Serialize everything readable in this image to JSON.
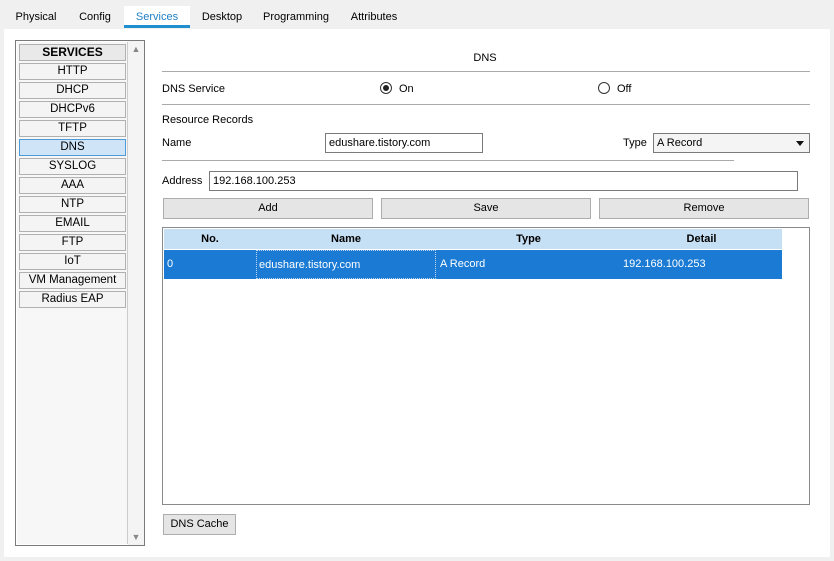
{
  "tabs": [
    {
      "label": "Physical"
    },
    {
      "label": "Config"
    },
    {
      "label": "Services"
    },
    {
      "label": "Desktop"
    },
    {
      "label": "Programming"
    },
    {
      "label": "Attributes"
    }
  ],
  "sidebar": {
    "header": "SERVICES",
    "items": [
      "HTTP",
      "DHCP",
      "DHCPv6",
      "TFTP",
      "DNS",
      "SYSLOG",
      "AAA",
      "NTP",
      "EMAIL",
      "FTP",
      "IoT",
      "VM Management",
      "Radius EAP"
    ],
    "active": "DNS"
  },
  "dns": {
    "title": "DNS",
    "service_label": "DNS Service",
    "on_label": "On",
    "off_label": "Off",
    "service_state": "On",
    "resource_records_label": "Resource Records",
    "name_label": "Name",
    "name_value": "edushare.tistory.com",
    "type_label": "Type",
    "type_value": "A Record",
    "address_label": "Address",
    "address_value": "192.168.100.253",
    "add_label": "Add",
    "save_label": "Save",
    "remove_label": "Remove",
    "cache_label": "DNS Cache"
  },
  "table": {
    "columns": [
      "No.",
      "Name",
      "Type",
      "Detail"
    ],
    "rows": [
      {
        "no": "0",
        "name": "edushare.tistory.com",
        "type": "A Record",
        "detail": "192.168.100.253"
      }
    ]
  },
  "colors": {
    "accent": "#1f8fd0",
    "selected_row": "#1a7ad4",
    "table_header": "#c5dff5"
  }
}
